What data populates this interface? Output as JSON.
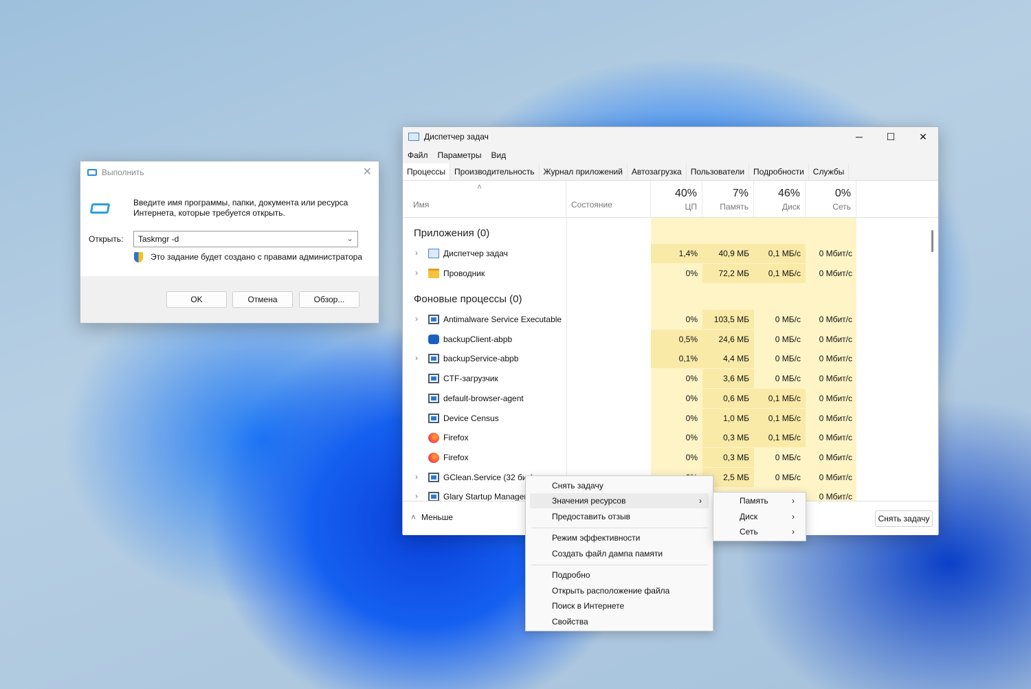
{
  "run": {
    "title": "Выполнить",
    "prompt": "Введите имя программы, папки, документа или ресурса Интернета, которые требуется открыть.",
    "open_label": "Открыть:",
    "open_value": "Taskmgr -d",
    "admin_note": "Это задание будет создано с правами администратора",
    "ok": "OK",
    "cancel": "Отмена",
    "browse": "Обзор..."
  },
  "tm": {
    "title": "Диспетчер задач",
    "menu": [
      "Файл",
      "Параметры",
      "Вид"
    ],
    "tabs": [
      "Процессы",
      "Производительность",
      "Журнал приложений",
      "Автозагрузка",
      "Пользователи",
      "Подробности",
      "Службы"
    ],
    "columns": {
      "name": "Имя",
      "status": "Состояние",
      "cpu_pct": "40%",
      "cpu": "ЦП",
      "mem_pct": "7%",
      "mem": "Память",
      "disk_pct": "46%",
      "disk": "Диск",
      "net_pct": "0%",
      "net": "Сеть"
    },
    "groups": {
      "apps": "Приложения (0)",
      "background": "Фоновые процессы (0)"
    },
    "apps": [
      {
        "name": "Диспетчер задач",
        "icon": "taskmgr-icon",
        "expand": true,
        "cpu": "1,4%",
        "mem": "40,9 МБ",
        "disk": "0,1 МБ/с",
        "net": "0 Мбит/с"
      },
      {
        "name": "Проводник",
        "icon": "folder-icon",
        "expand": true,
        "cpu": "0%",
        "mem": "72,2 МБ",
        "disk": "0,1 МБ/с",
        "net": "0 Мбит/с"
      }
    ],
    "background": [
      {
        "name": "Antimalware Service Executable",
        "icon": "app-icon",
        "expand": true,
        "cpu": "0%",
        "mem": "103,5 МБ",
        "disk": "0 МБ/с",
        "net": "0 Мбит/с"
      },
      {
        "name": "backupClient-abpb",
        "icon": "backup-icon",
        "expand": false,
        "cpu": "0,5%",
        "mem": "24,6 МБ",
        "disk": "0 МБ/с",
        "net": "0 Мбит/с"
      },
      {
        "name": "backupService-abpb",
        "icon": "app-icon",
        "expand": true,
        "cpu": "0,1%",
        "mem": "4,4 МБ",
        "disk": "0 МБ/с",
        "net": "0 Мбит/с"
      },
      {
        "name": "CTF-загрузчик",
        "icon": "app-icon",
        "expand": false,
        "cpu": "0%",
        "mem": "3,6 МБ",
        "disk": "0 МБ/с",
        "net": "0 Мбит/с"
      },
      {
        "name": "default-browser-agent",
        "icon": "app-icon",
        "expand": false,
        "cpu": "0%",
        "mem": "0,6 МБ",
        "disk": "0,1 МБ/с",
        "net": "0 Мбит/с"
      },
      {
        "name": "Device Census",
        "icon": "app-icon",
        "expand": false,
        "cpu": "0%",
        "mem": "1,0 МБ",
        "disk": "0,1 МБ/с",
        "net": "0 Мбит/с"
      },
      {
        "name": "Firefox",
        "icon": "firefox-icon",
        "expand": false,
        "cpu": "0%",
        "mem": "0,3 МБ",
        "disk": "0,1 МБ/с",
        "net": "0 Мбит/с"
      },
      {
        "name": "Firefox",
        "icon": "firefox-icon",
        "expand": false,
        "cpu": "0%",
        "mem": "0,3 МБ",
        "disk": "0 МБ/с",
        "net": "0 Мбит/с"
      },
      {
        "name": "GClean.Service (32 бит)",
        "icon": "app-icon",
        "expand": true,
        "cpu": "0%",
        "mem": "2,5 МБ",
        "disk": "0 МБ/с",
        "net": "0 Мбит/с"
      },
      {
        "name": "Glary Startup Manager",
        "icon": "app-icon",
        "expand": true,
        "cpu": "",
        "mem": "",
        "disk": "",
        "net": "0 Мбит/с"
      }
    ],
    "less": "Меньше",
    "end_task": "Снять задачу"
  },
  "context_menu": {
    "items": [
      "Снять задачу",
      "Значения ресурсов",
      "Предоставить отзыв",
      "Режим эффективности",
      "Создать файл дампа памяти",
      "Подробно",
      "Открыть расположение файла",
      "Поиск в Интернете",
      "Свойства"
    ],
    "highlighted": "Значения ресурсов"
  },
  "submenu": {
    "items": [
      "Память",
      "Диск",
      "Сеть"
    ]
  }
}
